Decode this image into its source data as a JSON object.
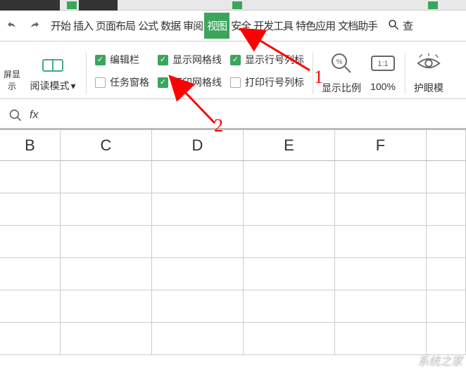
{
  "toolbar": {
    "tabs": {
      "start": "开始",
      "insert": "插入",
      "page_layout": "页面布局",
      "formula": "公式",
      "data": "数据",
      "review": "审阅",
      "view": "视图",
      "security": "安全",
      "dev_tools": "开发工具",
      "special": "特色应用",
      "doc_helper": "文档助手"
    },
    "search": "查"
  },
  "ribbon": {
    "screen_display": "屏显示",
    "reading_mode": "阅读模式",
    "edit_bar": "编辑栏",
    "task_pane": "任务窗格",
    "show_gridlines": "显示网格线",
    "print_gridlines": "打印网格线",
    "show_row_col_headers": "显示行号列标",
    "print_row_col_headers": "打印行号列标",
    "zoom_ratio": "显示比例",
    "hundred_percent": "100%",
    "eye_protection": "护眼模"
  },
  "fx": {
    "label": "fx",
    "value": ""
  },
  "columns": {
    "B": "B",
    "C": "C",
    "D": "D",
    "E": "E",
    "F": "F"
  },
  "annotations": {
    "one": "1",
    "two": "2"
  },
  "watermark": "系统之家"
}
